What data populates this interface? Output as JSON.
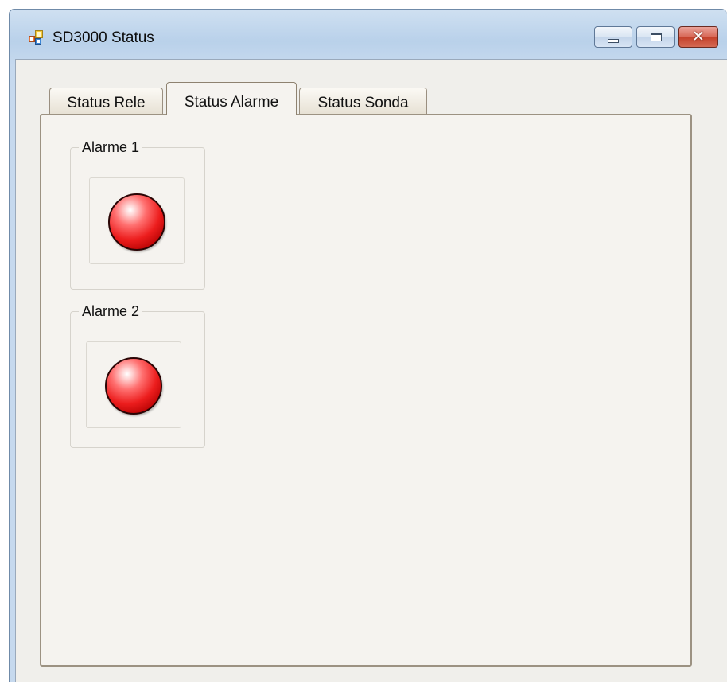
{
  "window": {
    "title": "SD3000 Status"
  },
  "tabs": [
    {
      "label": "Status Rele",
      "active": false
    },
    {
      "label": "Status Alarme",
      "active": true
    },
    {
      "label": "Status Sonda",
      "active": false
    }
  ],
  "alarms": [
    {
      "label": "Alarme 1",
      "indicator_color": "#e52020",
      "icon": "red-led-icon"
    },
    {
      "label": "Alarme 2",
      "indicator_color": "#e52020",
      "icon": "red-led-icon"
    }
  ],
  "colors": {
    "titlebar": "#c6d9ee",
    "client_background": "#f0efeb",
    "tab_page_background": "#f5f3ef",
    "close_button": "#c4412b"
  }
}
